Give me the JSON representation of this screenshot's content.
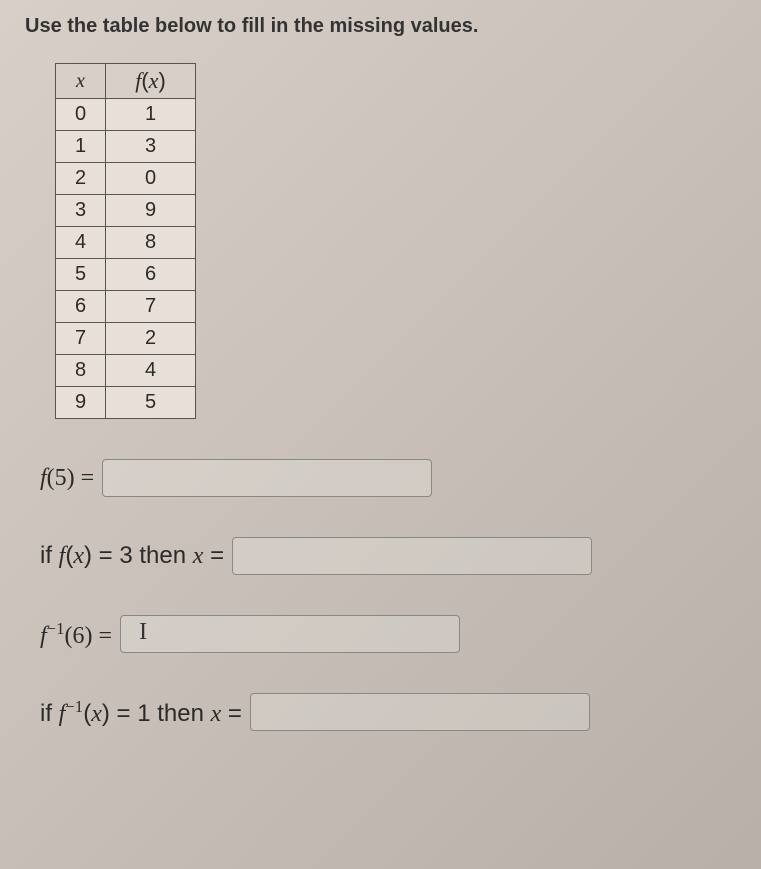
{
  "instruction": "Use the table below to fill in the missing values.",
  "table": {
    "header_x": "x",
    "header_fx": "f(x)",
    "rows": [
      {
        "x": "0",
        "fx": "1"
      },
      {
        "x": "1",
        "fx": "3"
      },
      {
        "x": "2",
        "fx": "0"
      },
      {
        "x": "3",
        "fx": "9"
      },
      {
        "x": "4",
        "fx": "8"
      },
      {
        "x": "5",
        "fx": "6"
      },
      {
        "x": "6",
        "fx": "7"
      },
      {
        "x": "7",
        "fx": "2"
      },
      {
        "x": "8",
        "fx": "4"
      },
      {
        "x": "9",
        "fx": "5"
      }
    ]
  },
  "q1": {
    "prefix": "f(5) ="
  },
  "q2": {
    "prefix": "if f(x) = 3 then x ="
  },
  "q3": {
    "prefix": "f⁻¹(6) =",
    "cursor": "I"
  },
  "q4": {
    "prefix": "if f⁻¹(x) = 1 then x ="
  },
  "chart_data": {
    "type": "table",
    "columns": [
      "x",
      "f(x)"
    ],
    "rows": [
      [
        0,
        1
      ],
      [
        1,
        3
      ],
      [
        2,
        0
      ],
      [
        3,
        9
      ],
      [
        4,
        8
      ],
      [
        5,
        6
      ],
      [
        6,
        7
      ],
      [
        7,
        2
      ],
      [
        8,
        4
      ],
      [
        9,
        5
      ]
    ]
  }
}
